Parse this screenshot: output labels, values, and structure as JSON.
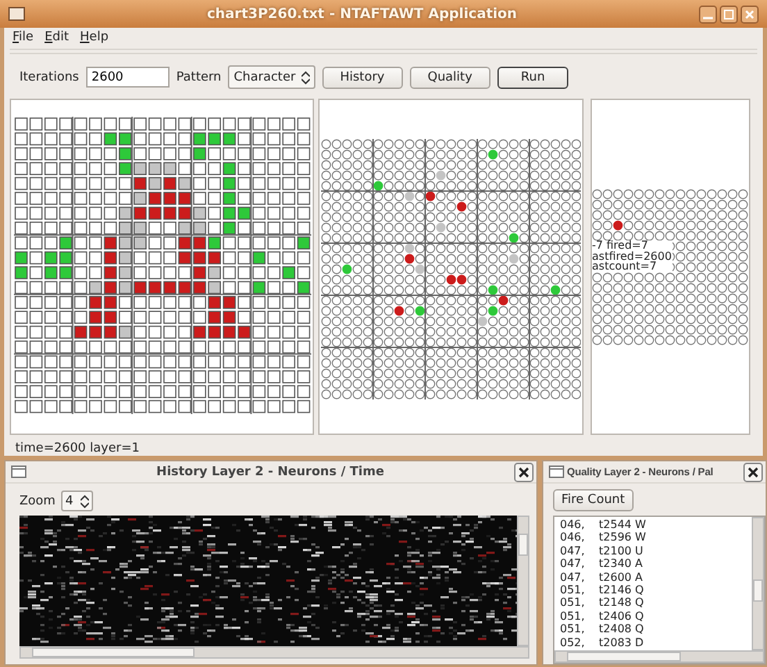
{
  "window": {
    "title": "chart3P260.txt - NTAFTAWT Application"
  },
  "menu": [
    "File",
    "Edit",
    "Help"
  ],
  "toolbar": {
    "iterations_label": "Iterations",
    "iterations": "2600",
    "pattern_label": "Pattern",
    "pattern": "Character",
    "buttons": [
      {
        "label": "History",
        "focused": false
      },
      {
        "label": "Quality",
        "focused": false
      },
      {
        "label": "Run",
        "focused": true
      }
    ]
  },
  "layers": [
    {
      "kind": "squares"
    },
    {
      "kind": "circles"
    },
    {
      "kind": "circles",
      "overlay": [
        "-7 fired=7",
        "astfired=2600",
        "astcount=7"
      ]
    }
  ],
  "status": "time=2600 layer=1",
  "history": {
    "title": "History Layer 2 - Neurons / Time",
    "zoom_label": "Zoom",
    "zoom": "4"
  },
  "quality": {
    "title": "Quality Layer 2 - Neurons / Pal",
    "button": "Fire Count",
    "rows": [
      {
        "neuron": "046,",
        "fire": "t2544 W"
      },
      {
        "neuron": "046,",
        "fire": "t2596 W"
      },
      {
        "neuron": "047,",
        "fire": "t2100 U"
      },
      {
        "neuron": "047,",
        "fire": "t2340 A"
      },
      {
        "neuron": "047,",
        "fire": "t2600 A"
      },
      {
        "neuron": "051,",
        "fire": "t2146 Q"
      },
      {
        "neuron": "051,",
        "fire": "t2148 Q"
      },
      {
        "neuron": "051,",
        "fire": "t2406 Q"
      },
      {
        "neuron": "051,",
        "fire": "t2408 Q"
      },
      {
        "neuron": "052,",
        "fire": "t2083 D"
      }
    ]
  }
}
